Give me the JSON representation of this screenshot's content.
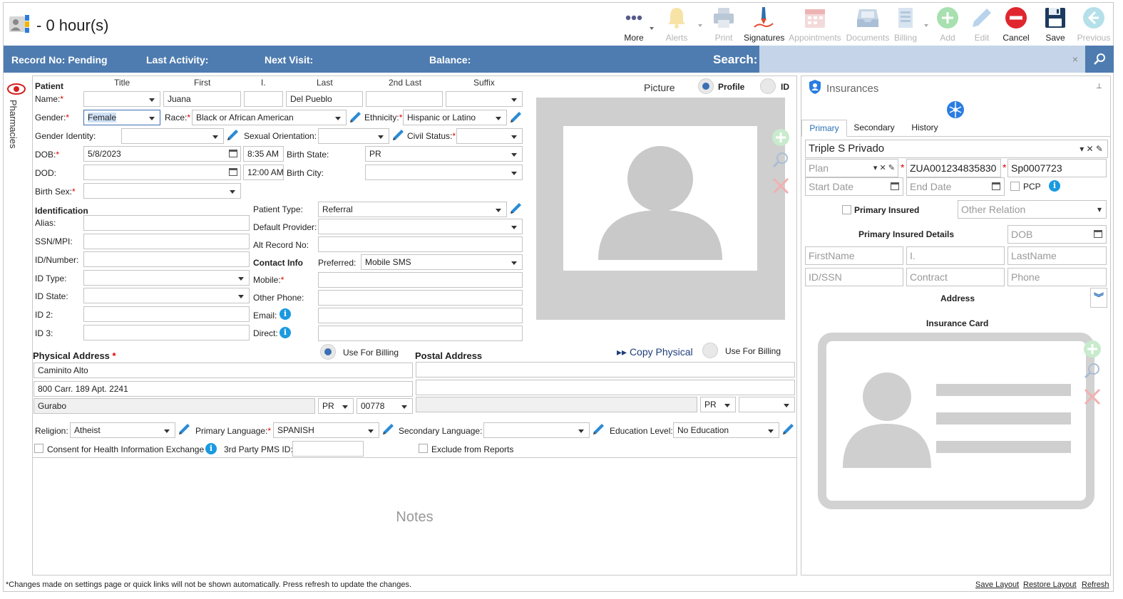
{
  "header": {
    "title": "- 0 hour(s)"
  },
  "toolbar": {
    "more": "More",
    "alerts": "Alerts",
    "print": "Print",
    "signatures": "Signatures",
    "appointments": "Appointments",
    "documents": "Documents",
    "billing": "Billing",
    "add": "Add",
    "edit": "Edit",
    "cancel": "Cancel",
    "save": "Save",
    "previous": "Previous"
  },
  "infobar": {
    "record_no": "Record No: Pending",
    "last_activity": "Last Activity:",
    "next_visit": "Next Visit:",
    "balance": "Balance:",
    "search_label": "Search:",
    "search_value": "",
    "clear": "×"
  },
  "sidetab": {
    "label": "Pharmacies"
  },
  "patient": {
    "section": "Patient",
    "col_headers": {
      "title": "Title",
      "first": "First",
      "initial": "I.",
      "last": "Last",
      "second_last": "2nd Last",
      "suffix": "Suffix"
    },
    "name_label": "Name:",
    "name_title": "",
    "name_first": "Juana",
    "name_initial": "",
    "name_last": "Del Pueblo",
    "name_second_last": "",
    "name_suffix": "",
    "gender_label": "Gender:",
    "gender": "Female",
    "race_label": "Race:",
    "race": "Black or African American",
    "ethnicity_label": "Ethnicity:",
    "ethnicity": "Hispanic or Latino",
    "gender_identity_label": "Gender Identity:",
    "gender_identity": "",
    "sexual_orientation_label": "Sexual Orientation:",
    "sexual_orientation": "",
    "civil_status_label": "Civil Status:",
    "civil_status": "",
    "dob_label": "DOB:",
    "dob": "5/8/2023",
    "dob_time": "8:35 AM",
    "birth_state_label": "Birth State:",
    "birth_state": "PR",
    "dod_label": "DOD:",
    "dod": "",
    "dod_time": "12:00 AM",
    "birth_city_label": "Birth City:",
    "birth_city": "",
    "birth_sex_label": "Birth Sex:",
    "birth_sex": ""
  },
  "identification": {
    "section": "Identification",
    "alias_label": "Alias:",
    "ssn_label": "SSN/MPI:",
    "id_number_label": "ID/Number:",
    "id_type_label": "ID Type:",
    "id_state_label": "ID State:",
    "id2_label": "ID 2:",
    "id3_label": "ID 3:",
    "patient_type_label": "Patient Type:",
    "patient_type": "Referral",
    "default_provider_label": "Default Provider:",
    "alt_record_label": "Alt Record No:",
    "contact_info": "Contact Info",
    "preferred_label": "Preferred:",
    "preferred": "Mobile SMS",
    "mobile_label": "Mobile:",
    "other_phone_label": "Other Phone:",
    "email_label": "Email:",
    "direct_label": "Direct:"
  },
  "picture": {
    "label": "Picture",
    "profile": "Profile",
    "id": "ID"
  },
  "physical_address": {
    "title": "Physical Address",
    "use_billing": "Use For Billing",
    "line1": "Caminito Alto",
    "line2": "800 Carr. 189 Apt. 2241",
    "city": "Gurabo",
    "state": "PR",
    "zip": "00778"
  },
  "postal_address": {
    "title": "Postal Address",
    "copy": "▸▸ Copy Physical",
    "use_billing": "Use For Billing",
    "line1": "",
    "line2": "",
    "city": "",
    "state": "PR",
    "zip": ""
  },
  "extras": {
    "religion_label": "Religion:",
    "religion": "Atheist",
    "primary_language_label": "Primary Language:",
    "primary_language": "SPANISH",
    "secondary_language_label": "Secondary Language:",
    "secondary_language": "",
    "education_label": "Education Level:",
    "education": "No Education",
    "consent": "Consent for Health Information Exchange",
    "pms_label": "3rd Party PMS ID:",
    "exclude": "Exclude from Reports"
  },
  "notes": {
    "placeholder": "Notes"
  },
  "insurances": {
    "title": "Insurances",
    "tabs": [
      "Primary",
      "Secondary",
      "History"
    ],
    "carrier": "Triple S Privado",
    "plan_placeholder": "Plan",
    "policy": "ZUA001234835830",
    "group": "Sp0007723",
    "start_placeholder": "Start Date",
    "end_placeholder": "End Date",
    "pcp": "PCP",
    "primary_insured": "Primary Insured",
    "other_relation": "Other Relation",
    "details_title": "Primary Insured Details",
    "dob_placeholder": "DOB",
    "firstname_placeholder": "FirstName",
    "initial_placeholder": "I.",
    "lastname_placeholder": "LastName",
    "idssn_placeholder": "ID/SSN",
    "contract_placeholder": "Contract",
    "phone_placeholder": "Phone",
    "address": "Address",
    "insurance_card": "Insurance Card"
  },
  "footer": {
    "note": "*Changes made on settings page or quick links will not be shown automatically. Press refresh to update the changes.",
    "save_layout": "Save Layout",
    "restore_layout": "Restore Layout",
    "refresh": "Refresh"
  }
}
